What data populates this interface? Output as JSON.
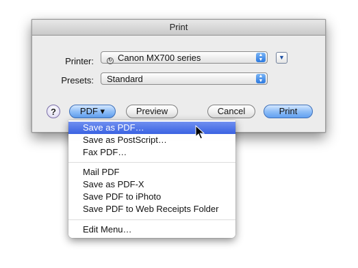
{
  "dialog": {
    "title": "Print",
    "printer_label": "Printer:",
    "printer_value": "Canon MX700 series",
    "presets_label": "Presets:",
    "presets_value": "Standard"
  },
  "buttons": {
    "help": "?",
    "pdf": "PDF ▾",
    "preview": "Preview",
    "cancel": "Cancel",
    "print": "Print"
  },
  "pdf_menu": {
    "items": [
      "Save as PDF…",
      "Save as PostScript…",
      "Fax PDF…",
      "Mail PDF",
      "Save as PDF-X",
      "Save PDF to iPhoto",
      "Save PDF to Web Receipts Folder",
      "Edit Menu…"
    ],
    "highlighted_index": 0
  },
  "colors": {
    "highlight": "#3a62e2",
    "default_button": "#62a0f0"
  },
  "icons": {
    "printer_status": "printer-status-icon",
    "popup_arrows": "up-down-arrows-icon",
    "disclosure": "disclosure-triangle-icon",
    "cursor": "mouse-pointer-icon"
  }
}
